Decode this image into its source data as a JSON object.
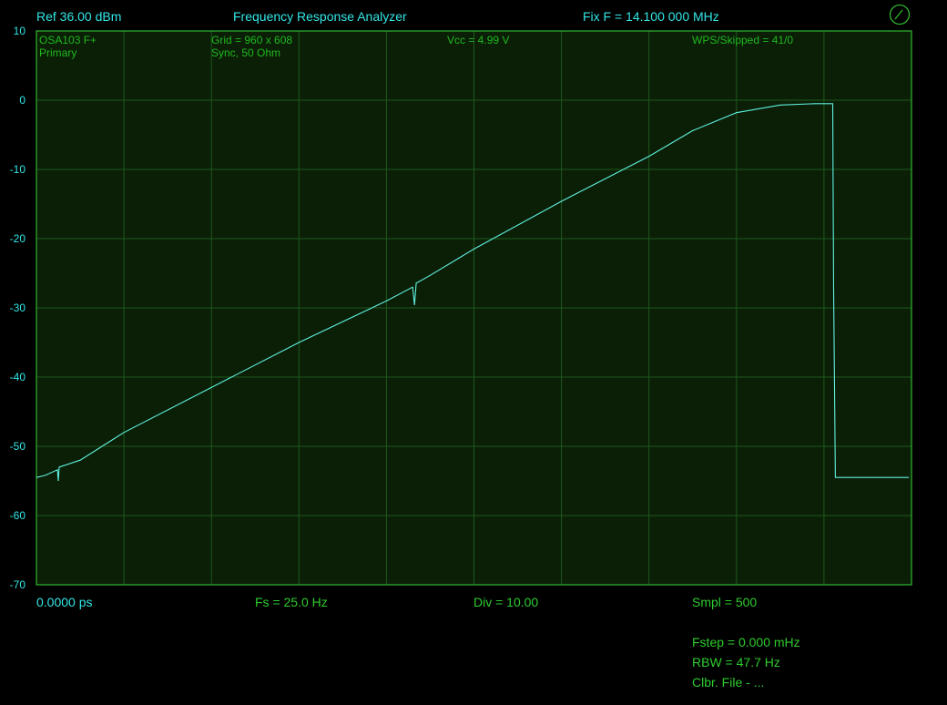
{
  "header": {
    "ref": "Ref  36.00 dBm",
    "title": "Frequency Response Analyzer",
    "fix_freq": "Fix F = 14.100 000 MHz"
  },
  "info": {
    "device": "OSA103 F+",
    "mode": "Primary",
    "grid": "Grid = 960 x 608",
    "sync": "Sync, 50 Ohm",
    "vcc": "Vcc = 4.99 V",
    "wps": "WPS/Skipped  = 41/0"
  },
  "footer": {
    "start": "0.0000 ps",
    "fs": "Fs = 25.0 Hz",
    "div": "Div = 10.00",
    "smpl": "Smpl = 500",
    "fstep": "Fstep = 0.000 mHz",
    "rbw": "RBW = 47.7 Hz",
    "clbr": "Clbr. File - ..."
  },
  "colors": {
    "background": "#000000",
    "plot_bg": "#0b1f06",
    "grid": "#1d5a1d",
    "border": "#2fb82f",
    "trace": "#5ff0e0",
    "header_text": "#33e6e6",
    "info_text": "#1fb81f"
  },
  "chart_data": {
    "type": "line",
    "title": "Frequency Response Analyzer",
    "xlabel": "",
    "ylabel": "",
    "y_ticks": [
      "10",
      "0",
      "-10",
      "-20",
      "-30",
      "-40",
      "-50",
      "-60",
      "-70"
    ],
    "ylim": [
      -70,
      10
    ],
    "x_divisions": 10,
    "grid": true,
    "series": [
      {
        "x": [
          0,
          0.1,
          0.24,
          0.25,
          0.26,
          0.5,
          1.0,
          2.0,
          3.0,
          4.0,
          4.3,
          4.32,
          4.34,
          4.36,
          4.5,
          5.0,
          6.0,
          7.0,
          7.5,
          8.0,
          8.5,
          8.9,
          9.0,
          9.1,
          9.11,
          9.13,
          9.5,
          9.97
        ],
        "y": [
          -54.5,
          -54.2,
          -53.4,
          -55.0,
          -53.0,
          -52.0,
          -48.0,
          -41.5,
          -35.0,
          -29.0,
          -27.0,
          -29.6,
          -26.4,
          -26.3,
          -25.3,
          -21.5,
          -14.6,
          -8.1,
          -4.4,
          -1.8,
          -0.7,
          -0.5,
          -0.5,
          -0.5,
          -27.5,
          -54.5,
          -54.5,
          -54.5
        ]
      }
    ]
  }
}
